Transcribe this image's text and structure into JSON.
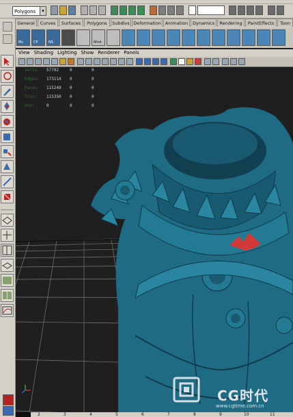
{
  "status_line": {
    "mode": "Polygons"
  },
  "shelf_tabs": [
    "General",
    "Curves",
    "Surfaces",
    "Polygons",
    "Subdivs",
    "Deformation",
    "Animation",
    "Dynamics",
    "Rendering",
    "PaintEffects",
    "Toon"
  ],
  "shelf_icons": [
    {
      "label": "Mc",
      "color": "#3a6a9a"
    },
    {
      "label": "CP",
      "color": "#3a6a9a"
    },
    {
      "label": "NS",
      "color": "#3a6a9a"
    },
    {
      "label": "",
      "color": "#4b4b4b"
    },
    {
      "label": "",
      "color": "#bdbdbd"
    },
    {
      "label": "Mrrd",
      "color": "#bdbdbd"
    },
    {
      "label": "",
      "color": "#bdbdbd"
    }
  ],
  "panel_menu": [
    "View",
    "Shading",
    "Lighting",
    "Show",
    "Renderer",
    "Panels"
  ],
  "hud_stats": [
    {
      "label": "Verts:",
      "a": "57792",
      "b": "0",
      "c": "0"
    },
    {
      "label": "Edges:",
      "a": "173114",
      "b": "0",
      "c": "0"
    },
    {
      "label": "Faces:",
      "a": "115249",
      "b": "0",
      "c": "0"
    },
    {
      "label": "Tris:",
      "a": "115350",
      "b": "0",
      "c": "0"
    },
    {
      "label": "UVs:",
      "a": "0",
      "b": "0",
      "c": "0"
    }
  ],
  "timeline_ticks": [
    "2",
    "3",
    "4",
    "5",
    "6",
    "7",
    "8",
    "9",
    "10",
    "11"
  ],
  "watermark": {
    "brand": "CG时代",
    "url": "www.cgtime.com.cn"
  },
  "colors": {
    "model": "#1f6b84",
    "model_dark": "#123f50",
    "viewport_bg": "#1f1f1f",
    "highlight": "#d23a3a",
    "ui_bg": "#d4d0c8"
  }
}
